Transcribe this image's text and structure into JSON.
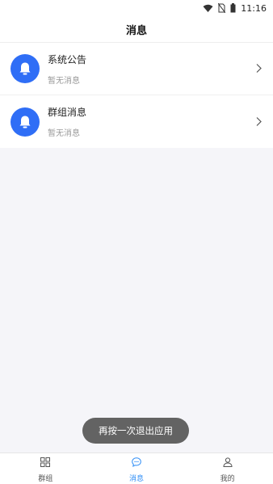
{
  "status_bar": {
    "time": "11:16"
  },
  "header": {
    "title": "消息"
  },
  "conversations": [
    {
      "title": "系统公告",
      "subtitle": "暂无消息",
      "icon": "bell-icon"
    },
    {
      "title": "群组消息",
      "subtitle": "暂无消息",
      "icon": "bell-icon"
    }
  ],
  "toast": {
    "text": "再按一次退出应用"
  },
  "tabbar": {
    "tabs": [
      {
        "label": "群组",
        "icon": "grid-icon",
        "active": false
      },
      {
        "label": "消息",
        "icon": "chat-bubble-icon",
        "active": true
      },
      {
        "label": "我的",
        "icon": "user-icon",
        "active": false
      }
    ]
  },
  "colors": {
    "accent": "#2f6ef6",
    "tab_active": "#2f8ef6",
    "toast_bg": "#636363",
    "page_bg": "#f5f5f9"
  }
}
